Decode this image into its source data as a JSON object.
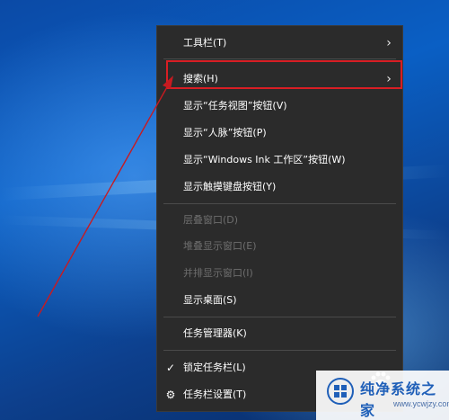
{
  "menu": {
    "items": [
      {
        "label": "工具栏(T)",
        "submenu": true
      },
      {
        "label": "搜索(H)",
        "submenu": true
      },
      {
        "label": "显示“任务视图”按钮(V)"
      },
      {
        "label": "显示“人脉”按钮(P)"
      },
      {
        "label": "显示“Windows Ink 工作区”按钮(W)"
      },
      {
        "label": "显示触摸键盘按钮(Y)"
      },
      {
        "label": "层叠窗口(D)",
        "disabled": true
      },
      {
        "label": "堆叠显示窗口(E)",
        "disabled": true
      },
      {
        "label": "并排显示窗口(I)",
        "disabled": true
      },
      {
        "label": "显示桌面(S)"
      },
      {
        "label": "任务管理器(K)"
      },
      {
        "label": "锁定任务栏(L)",
        "icon": "checkmark-icon"
      },
      {
        "label": "任务栏设置(T)",
        "icon": "gear-icon"
      }
    ]
  },
  "watermark": {
    "title": "纯净系统之家",
    "url": "www.ycwjzy.com"
  },
  "colors": {
    "menu_bg": "#2b2b2b",
    "highlight_border": "#d81e24",
    "disabled_text": "#6e6e6e"
  }
}
